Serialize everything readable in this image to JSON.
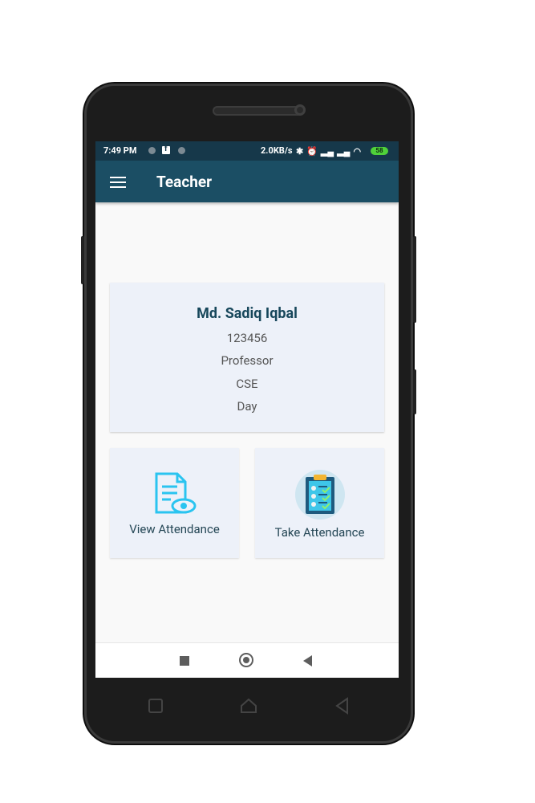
{
  "status_bar": {
    "time": "7:49 PM",
    "speed": "2.0KB/s",
    "battery": "58"
  },
  "app_bar": {
    "title": "Teacher",
    "color": "#1b4e64"
  },
  "profile": {
    "name": "Md. Sadiq Iqbal",
    "id": "123456",
    "designation": "Professor",
    "department": "CSE",
    "shift": "Day"
  },
  "actions": {
    "view_attendance": "View Attendance",
    "take_attendance": "Take Attendance"
  },
  "icons": {
    "menu": "hamburger-menu-icon",
    "view": "document-eye-icon",
    "take": "clipboard-checklist-icon",
    "nav_recent": "square-icon",
    "nav_home": "circle-icon",
    "nav_back": "triangle-back-icon"
  },
  "colors": {
    "status_bar": "#16384a",
    "card_bg": "#edf1f9",
    "accent_cyan": "#29c3f0",
    "name_text": "#17475b"
  }
}
